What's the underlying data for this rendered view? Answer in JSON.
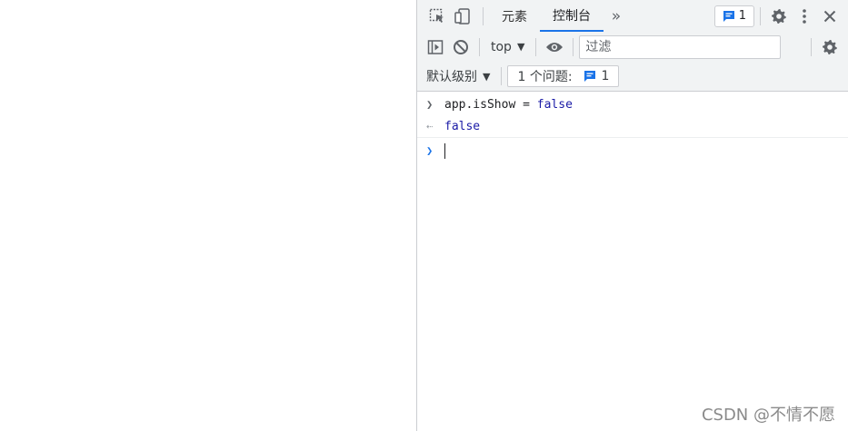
{
  "devtools": {
    "tabs": [
      {
        "label": "元素",
        "active": false
      },
      {
        "label": "控制台",
        "active": true
      }
    ],
    "more_tabs_glyph": "»",
    "issues_badge_count": "1",
    "context_selector": "top",
    "filter_placeholder": "过滤",
    "log_levels": "默认级别",
    "issues_count_label": "1 个问题:",
    "issues_count_value": "1",
    "accent_color": "#1a73e8",
    "icons": [
      "inspect-element-icon",
      "device-toolbar-icon",
      "more-tabs-icon",
      "issues-icon",
      "settings-icon",
      "more-options-icon",
      "close-icon",
      "sidebar-toggle-icon",
      "clear-console-icon",
      "live-expression-eye-icon",
      "console-settings-icon"
    ]
  },
  "console": {
    "input_expr": "app.isShow",
    "input_op": " = ",
    "input_value": "false",
    "result_value": "false"
  },
  "watermark": "CSDN @不情不愿"
}
